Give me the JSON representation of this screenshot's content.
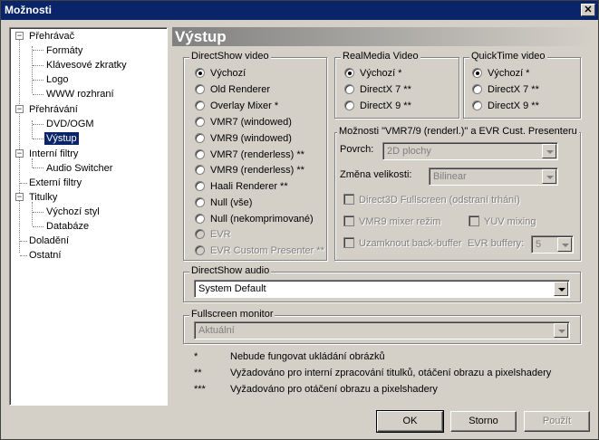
{
  "window": {
    "title": "Možnosti",
    "close_glyph": "✕"
  },
  "tree": {
    "items": [
      {
        "label": "Přehrávač",
        "level": 0,
        "expander": "−"
      },
      {
        "label": "Formáty",
        "level": 1
      },
      {
        "label": "Klávesové zkratky",
        "level": 1
      },
      {
        "label": "Logo",
        "level": 1
      },
      {
        "label": "WWW rozhraní",
        "level": 1
      },
      {
        "label": "Přehrávání",
        "level": 0,
        "expander": "−"
      },
      {
        "label": "DVD/OGM",
        "level": 1
      },
      {
        "label": "Výstup",
        "level": 1,
        "selected": true
      },
      {
        "label": "Interní filtry",
        "level": 0,
        "expander": "−"
      },
      {
        "label": "Audio Switcher",
        "level": 1
      },
      {
        "label": "Externí filtry",
        "level": 0
      },
      {
        "label": "Titulky",
        "level": 0,
        "expander": "−"
      },
      {
        "label": "Výchozí styl",
        "level": 1
      },
      {
        "label": "Databáze",
        "level": 1
      },
      {
        "label": "Doladění",
        "level": 0
      },
      {
        "label": "Ostatní",
        "level": 0
      }
    ]
  },
  "page": {
    "title": "Výstup"
  },
  "directshow_video": {
    "label": "DirectShow video",
    "options": [
      {
        "label": "Výchozí",
        "checked": true,
        "enabled": true
      },
      {
        "label": "Old Renderer",
        "checked": false,
        "enabled": true
      },
      {
        "label": "Overlay Mixer *",
        "checked": false,
        "enabled": true
      },
      {
        "label": "VMR7 (windowed)",
        "checked": false,
        "enabled": true
      },
      {
        "label": "VMR9 (windowed)",
        "checked": false,
        "enabled": true
      },
      {
        "label": "VMR7 (renderless) **",
        "checked": false,
        "enabled": true
      },
      {
        "label": "VMR9 (renderless) **",
        "checked": false,
        "enabled": true
      },
      {
        "label": "Haali Renderer **",
        "checked": false,
        "enabled": true
      },
      {
        "label": "Null (vše)",
        "checked": false,
        "enabled": true
      },
      {
        "label": "Null (nekomprimované)",
        "checked": false,
        "enabled": true
      },
      {
        "label": "EVR",
        "checked": false,
        "enabled": false
      },
      {
        "label": "EVR Custom Presenter **",
        "checked": false,
        "enabled": false
      }
    ]
  },
  "realmedia_video": {
    "label": "RealMedia Video",
    "options": [
      {
        "label": "Výchozí *",
        "checked": true
      },
      {
        "label": "DirectX 7 **",
        "checked": false
      },
      {
        "label": "DirectX 9 **",
        "checked": false
      }
    ]
  },
  "quicktime_video": {
    "label": "QuickTime video",
    "options": [
      {
        "label": "Výchozí *",
        "checked": true
      },
      {
        "label": "DirectX 7 **",
        "checked": false
      },
      {
        "label": "DirectX 9 **",
        "checked": false
      }
    ]
  },
  "vmr_options": {
    "label": "Možnosti \"VMR7/9 (renderl.)\" a EVR Cust. Presenteru",
    "surface_label": "Povrch:",
    "surface_value": "2D plochy",
    "resize_label": "Změna velikosti:",
    "resize_value": "Bilinear",
    "d3d_fullscreen": "Direct3D Fullscreen (odstraní trhání)",
    "vmr9_mixer": "VMR9 mixer režim",
    "yuv_mixing": "YUV mixing",
    "lock_backbuffer": "Uzamknout back-buffer",
    "evr_buffers_label": "EVR buffery:",
    "evr_buffers_value": "5"
  },
  "directshow_audio": {
    "label": "DirectShow audio",
    "value": "System Default"
  },
  "fullscreen_monitor": {
    "label": "Fullscreen monitor",
    "value": "Aktuální"
  },
  "notes": [
    {
      "mark": "*",
      "text": "Nebude fungovat ukládání obrázků"
    },
    {
      "mark": "**",
      "text": "Vyžadováno pro interní zpracování titulků, otáčení obrazu a pixelshadery"
    },
    {
      "mark": "***",
      "text": "Vyžadováno pro otáčení obrazu a pixelshadery"
    }
  ],
  "buttons": {
    "ok": "OK",
    "cancel": "Storno",
    "apply": "Použít"
  }
}
